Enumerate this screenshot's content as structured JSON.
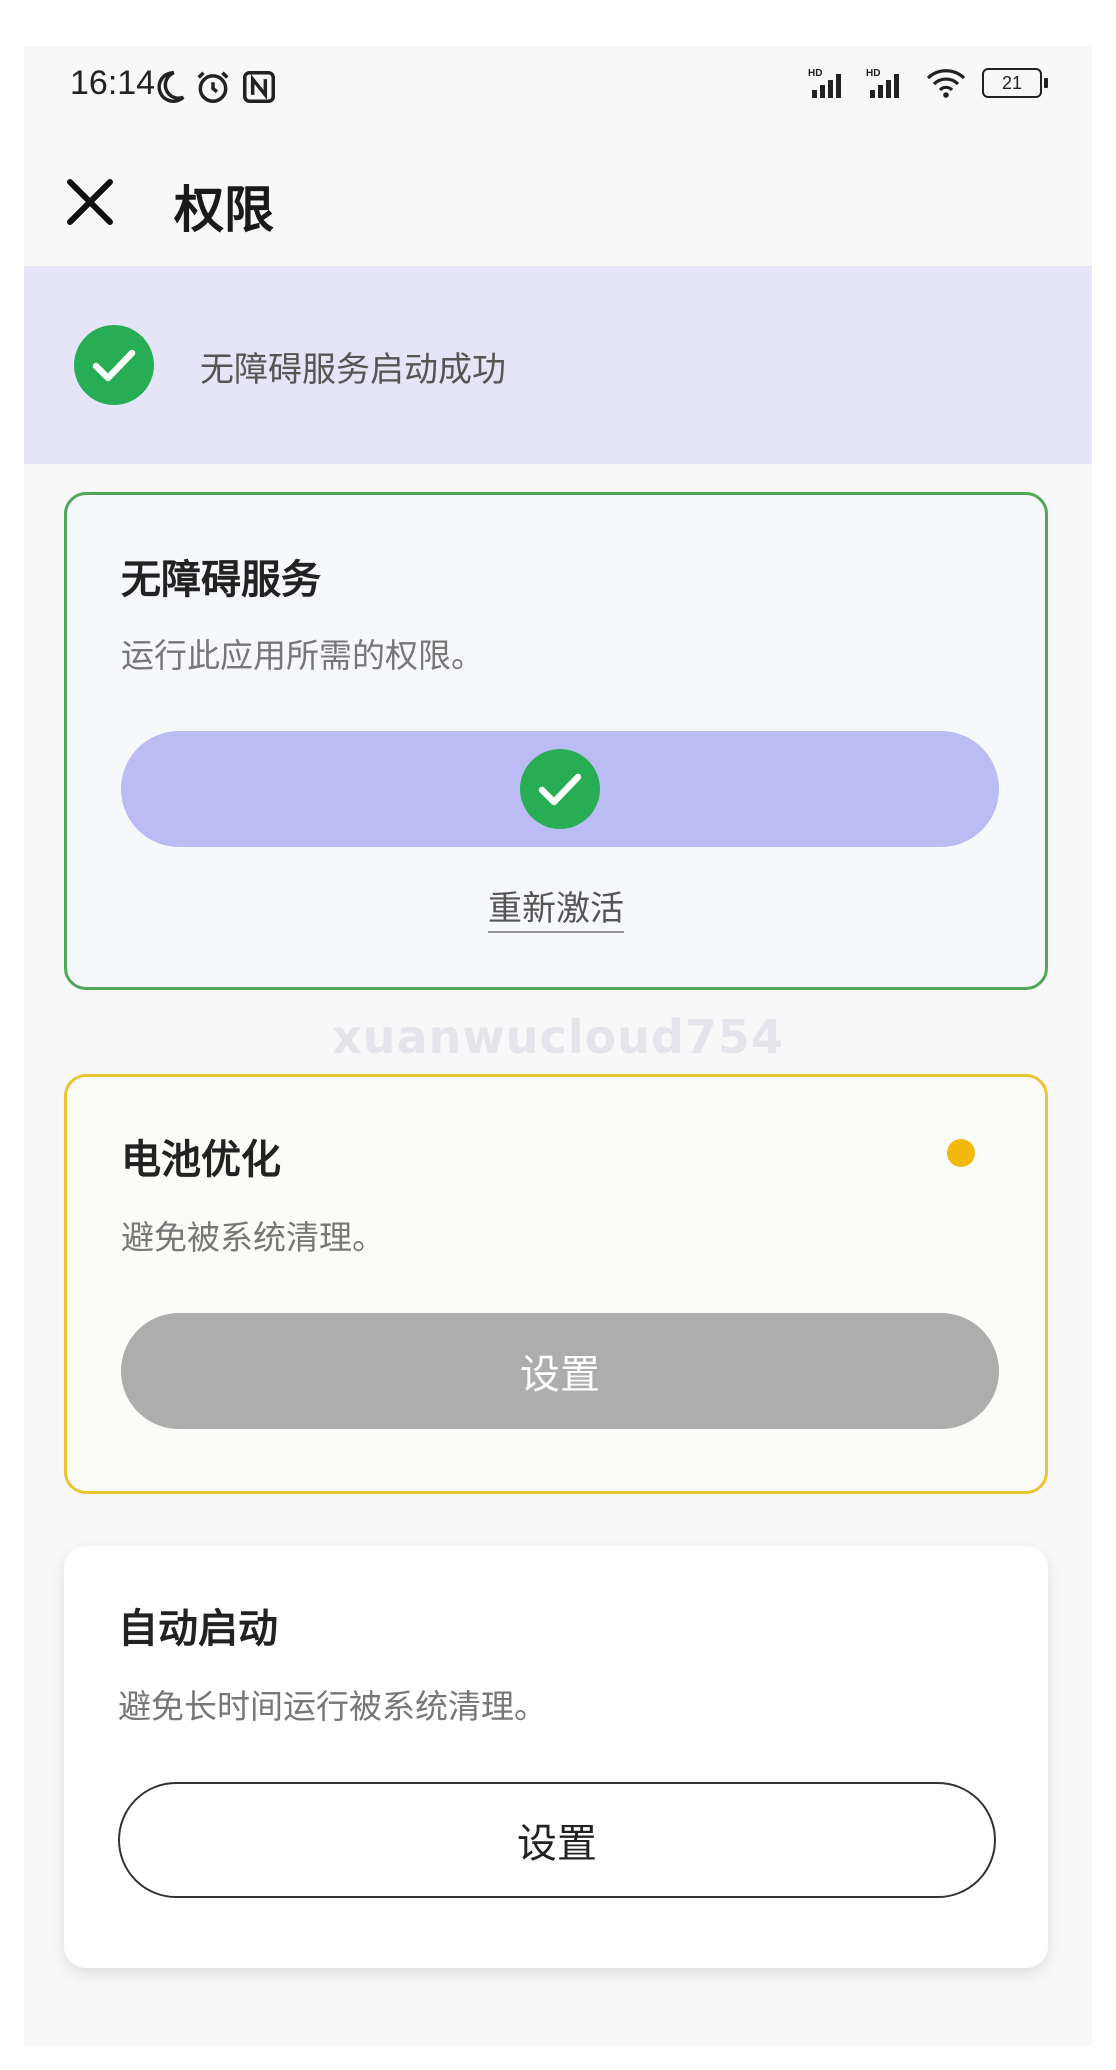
{
  "status_bar": {
    "time": "16:14",
    "battery": "21",
    "icons": [
      "moon-icon",
      "alarm-icon",
      "nfc-icon",
      "hd-signal-icon",
      "hd-signal-icon",
      "wifi-icon",
      "battery-icon"
    ]
  },
  "header": {
    "title": "权限",
    "close_icon": "close-icon"
  },
  "banner": {
    "text": "无障碍服务启动成功",
    "icon": "check-circle-icon"
  },
  "cards": [
    {
      "title": "无障碍服务",
      "description": "运行此应用所需的权限。",
      "button_icon": "check-circle-icon",
      "link": "重新激活",
      "accent": "#52a85a"
    },
    {
      "title": "电池优化",
      "description": "避免被系统清理。",
      "button_label": "设置",
      "accent": "#e9c532",
      "status_color": "#f3b90a"
    },
    {
      "title": "自动启动",
      "description": "避免长时间运行被系统清理。",
      "button_label": "设置"
    }
  ],
  "watermark": "xuanwucloud754",
  "colors": {
    "banner_bg": "#e6e5f7",
    "check_green": "#27ae55",
    "accessibility_button": "#bbbcf3",
    "disabled_button": "#adadad"
  }
}
